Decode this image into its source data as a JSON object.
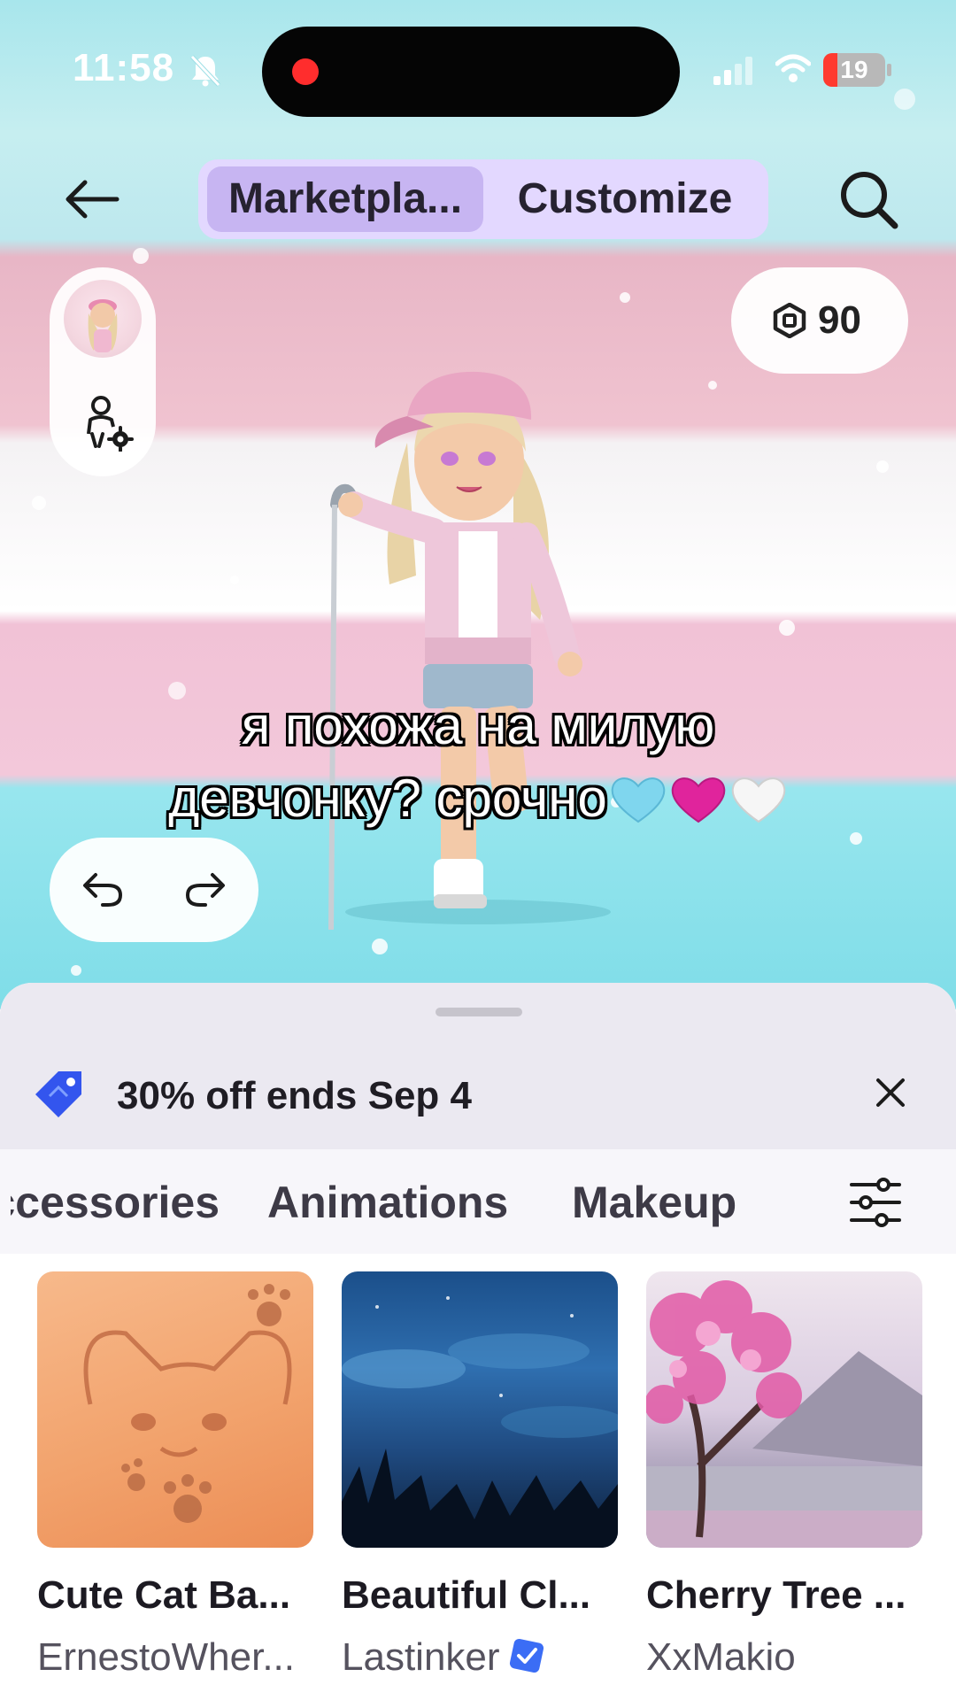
{
  "status_bar": {
    "time": "11:58",
    "battery": "19"
  },
  "header": {
    "tabs": [
      {
        "label": "Marketpla..."
      },
      {
        "label": "Customize"
      }
    ]
  },
  "wallet": {
    "robux": "90"
  },
  "caption": {
    "line1": "я похожа на милую",
    "line2": "девчонку? срочно"
  },
  "promo": {
    "text": "30% off ends Sep 4"
  },
  "category_tabs": [
    {
      "label": "Accessories"
    },
    {
      "label": "Animations"
    },
    {
      "label": "Makeup"
    }
  ],
  "items": [
    {
      "title": "Cute Cat Ba...",
      "creator": "ErnestoWher..."
    },
    {
      "title": "Beautiful Cl...",
      "creator": "Lastinker"
    },
    {
      "title": "Cherry Tree ...",
      "creator": "XxMakio"
    }
  ],
  "colors": {
    "accent": "#c7b5f2",
    "segment_bg": "#e3d8ff",
    "tag_blue": "#3355ee",
    "verified_blue": "#3b6df5"
  }
}
